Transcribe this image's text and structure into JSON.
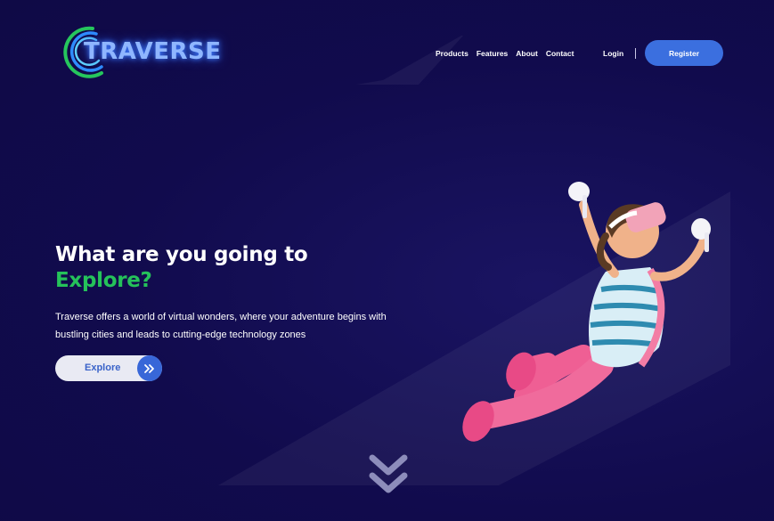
{
  "header": {
    "logo_text": "TRAVERSE",
    "nav": [
      {
        "label": "Products"
      },
      {
        "label": "Features"
      },
      {
        "label": "About"
      },
      {
        "label": "Contact"
      }
    ],
    "login_label": "Login",
    "register_label": "Register"
  },
  "hero": {
    "title_line1": "What are you going to",
    "title_accent": "Explore?",
    "description": "Traverse offers a world of virtual wonders, where your adventure begins with bustling cities and leads to cutting-edge technology zones",
    "explore_label": "Explore"
  },
  "icons": {
    "explore": "double-chevron-right-icon",
    "scroll": "double-chevron-down-icon",
    "logo": "traverse-logo-icon"
  },
  "colors": {
    "background": "#110b4d",
    "accent_green": "#25c25a",
    "primary_blue": "#3b6fdf",
    "logo_glow": "#8fb6ff"
  }
}
